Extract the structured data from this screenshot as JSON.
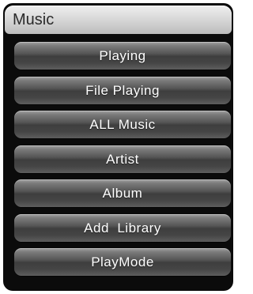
{
  "window": {
    "title": "Music"
  },
  "menu": {
    "items": [
      {
        "label": "Playing"
      },
      {
        "label": "File Playing"
      },
      {
        "label": "ALL Music"
      },
      {
        "label": "Artist"
      },
      {
        "label": "Album"
      },
      {
        "label": "Add  Library"
      },
      {
        "label": "PlayMode"
      }
    ]
  },
  "colors": {
    "background": "#0b0b0b",
    "title_bar": "#d9d9d9",
    "title_text": "#2a2a2a",
    "item_text": "#ffffff",
    "item_top": "#a3a3a3",
    "item_bottom": "#3e3e3e"
  }
}
